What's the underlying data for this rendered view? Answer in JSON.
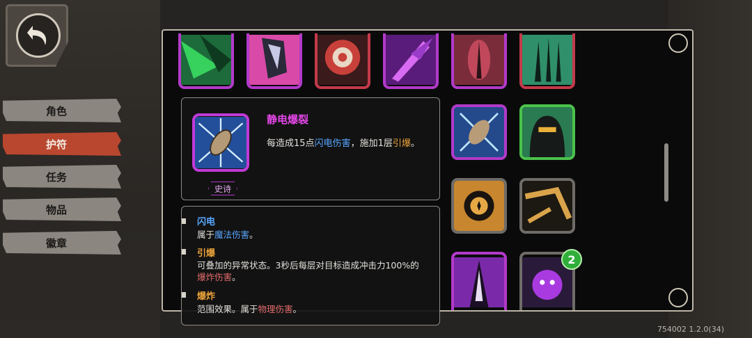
{
  "nav": {
    "back_icon": "back-arrow-icon",
    "menu": [
      "角色",
      "护符",
      "任务",
      "物品",
      "徽章"
    ],
    "active_index": 1
  },
  "tooltip": {
    "name": "静电爆裂",
    "desc_parts": [
      "每造成15点",
      "闪电伤害",
      "，施加1层",
      "引爆",
      "。"
    ],
    "rarity": "史诗",
    "keywords": [
      {
        "title": "闪电",
        "title_color": "#58a6ff",
        "desc_parts": [
          "属于",
          "魔法伤害",
          "。"
        ]
      },
      {
        "title": "引爆",
        "title_color": "#e9a23a",
        "desc_line1": "可叠加的异常状态。3秒后每层对目标造成冲击力100%的",
        "desc_line2_hl": "爆炸伤害",
        "desc_line2_end": "。"
      },
      {
        "title": "爆炸",
        "title_color": "#e9a23a",
        "desc_parts": [
          "范围效果。属于",
          "物理伤害",
          "。"
        ]
      }
    ]
  },
  "badge_count": "2",
  "version": "754002 1.2.0(34)",
  "colors": {
    "active_menu": "#b9472f",
    "epic": "#b23ac9"
  }
}
